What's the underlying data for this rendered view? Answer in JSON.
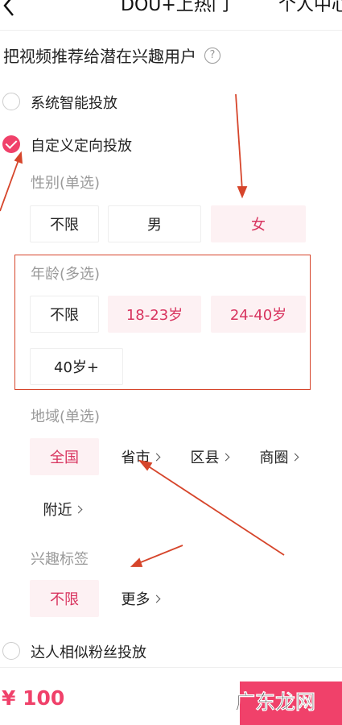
{
  "header": {
    "back_icon": "chevron-left-icon",
    "title": "DOU+上热门",
    "right_text": "个人中心"
  },
  "intro": {
    "text": "把视频推荐给潜在兴趣用户",
    "help_icon": "question-circle-icon"
  },
  "options": {
    "system": "系统智能投放",
    "custom": "自定义定向投放",
    "similar": "达人相似粉丝投放",
    "selected": "custom"
  },
  "gender": {
    "label": "性别(单选)",
    "choices": [
      "不限",
      "男",
      "女"
    ],
    "selected": "女"
  },
  "age": {
    "label": "年龄(多选)",
    "choices": [
      "不限",
      "18-23岁",
      "24-40岁",
      "40岁+"
    ],
    "selected": [
      "18-23岁",
      "24-40岁"
    ]
  },
  "region": {
    "label": "地域(单选)",
    "choices": [
      "全国",
      "省市",
      "区县",
      "商圈",
      "附近"
    ],
    "selected": "全国"
  },
  "interest": {
    "label": "兴趣标签",
    "choices": [
      "不限",
      "更多"
    ],
    "selected": "不限"
  },
  "footer": {
    "price": "¥ 100",
    "watermark": "广东龙网"
  },
  "colors": {
    "accent": "#f0416a",
    "selected_bg": "#fdf1f3",
    "annotation": "#d6452b"
  }
}
